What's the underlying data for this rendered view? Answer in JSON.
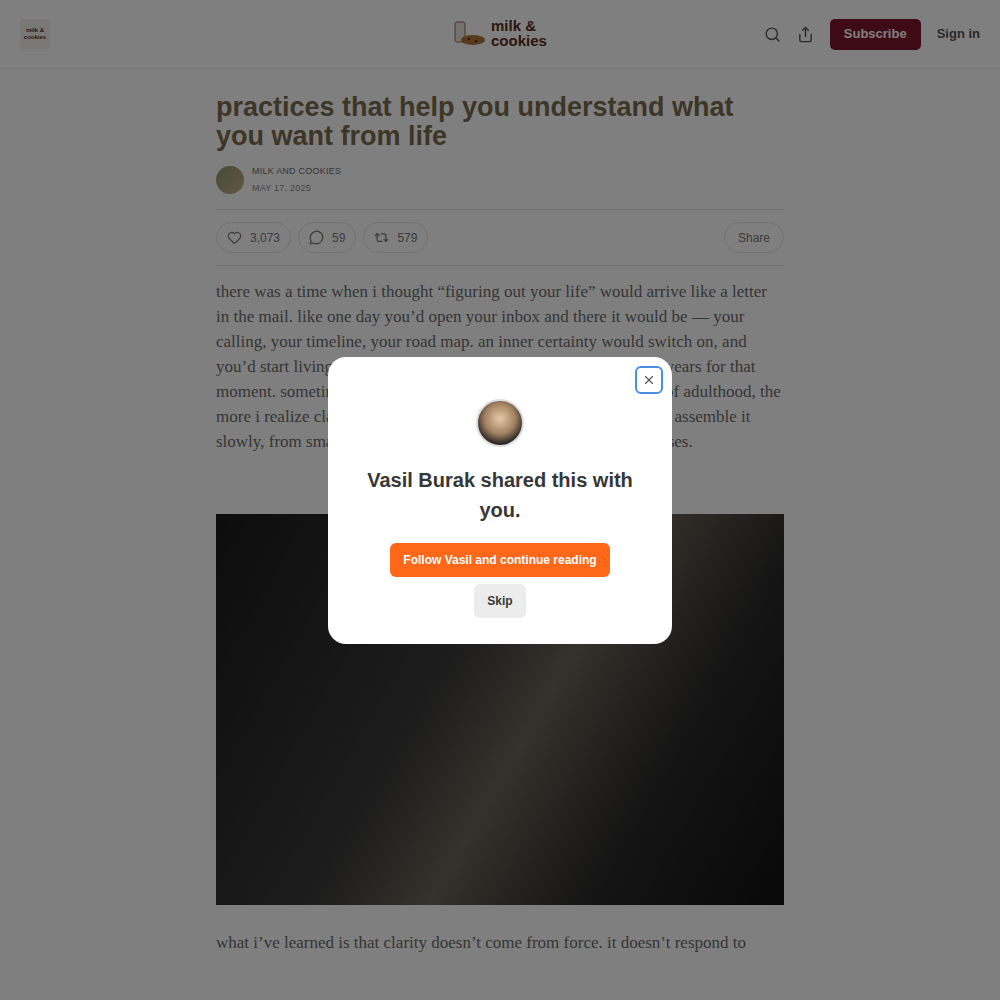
{
  "header": {
    "logo": "milk & cookies",
    "subscribe": "Subscribe",
    "sign_in": "Sign in"
  },
  "article": {
    "title": "practices that help you understand what you want from life",
    "author": "MILK AND COOKIES",
    "date": "MAY 17, 2025",
    "stats": {
      "likes": "3,073",
      "comments": "59",
      "restacks": "579"
    },
    "share": "Share",
    "paragraphs": [
      "there was a time when i thought “figuring out your life” would arrive like a letter in the mail. like one day you’d open your inbox and there it would be — your calling, your timeline, your road map. an inner certainty would switch on, and you’d start living with crisp direction and a natural glow. i waited years for that moment. sometimes i still do. but the deeper i wade into the mess of adulthood, the more i realize clarity doesn’t arrive in one dramatic download. you assemble it slowly, from small longings, gentle pivots, and the body’s quiet yeses."
    ],
    "closing_line": "what i’ve learned is that clarity doesn’t come from force. it doesn’t respond to"
  },
  "modal": {
    "message": "Vasil Burak shared this with you.",
    "primary_button": "Follow Vasil and continue reading",
    "secondary_button": "Skip"
  }
}
